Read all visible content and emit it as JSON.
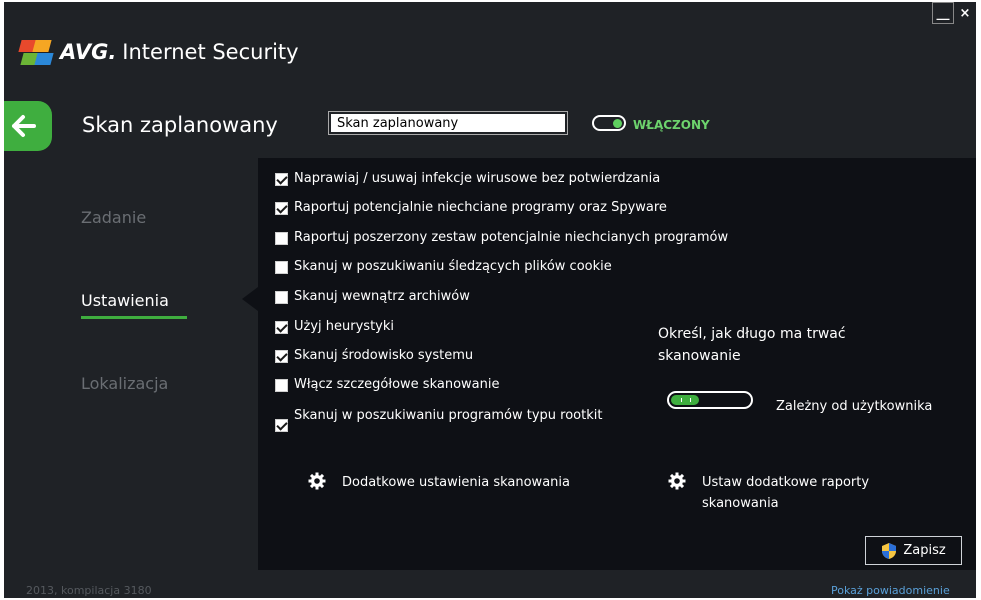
{
  "window": {
    "minimize_label": "__",
    "close_label": "×"
  },
  "app": {
    "brand": "AVG.",
    "product": "Internet Security",
    "logo_colors": [
      "#e8492c",
      "#f5a623",
      "#6bb536",
      "#2b88d8"
    ]
  },
  "header": {
    "back_icon": "arrow-left-icon",
    "title": "Skan zaplanowany",
    "name_value": "Skan zaplanowany",
    "toggle_state_label": "WŁĄCZONY",
    "toggle_on": true
  },
  "sidebar": {
    "items": [
      {
        "label": "Zadanie",
        "active": false
      },
      {
        "label": "Ustawienia",
        "active": true
      },
      {
        "label": "Lokalizacja",
        "active": false
      }
    ]
  },
  "settings": {
    "options": [
      {
        "label": "Naprawiaj / usuwaj infekcje wirusowe bez potwierdzania",
        "checked": true
      },
      {
        "label": "Raportuj potencjalnie niechciane programy oraz Spyware",
        "checked": true
      },
      {
        "label": "Raportuj poszerzony zestaw potencjalnie niechcianych programów",
        "checked": false
      },
      {
        "label": "Skanuj w poszukiwaniu śledzących plików cookie",
        "checked": false
      },
      {
        "label": "Skanuj wewnątrz archiwów",
        "checked": false
      },
      {
        "label": "Użyj heurystyki",
        "checked": true
      },
      {
        "label": "Skanuj środowisko systemu",
        "checked": true
      },
      {
        "label": "Włącz szczegółowe skanowanie",
        "checked": false
      },
      {
        "label": "Skanuj w poszukiwaniu programów typu rootkit",
        "checked": true
      }
    ],
    "duration_title": "Określ, jak długo ma trwać skanowanie",
    "duration_label": "Zależny od użytkownika",
    "additional_settings_link": "Dodatkowe ustawienia skanowania",
    "additional_reports_link": "Ustaw dodatkowe raporty skanowania",
    "save_label": "Zapisz"
  },
  "footer": {
    "build": "2013, kompilacja 3180",
    "notification_link": "Pokaż powiadomienie"
  },
  "colors": {
    "accent_green": "#3fae3f",
    "panel_bg": "#0e1015",
    "window_bg": "#1f2226",
    "link_blue": "#5aa0d8"
  }
}
